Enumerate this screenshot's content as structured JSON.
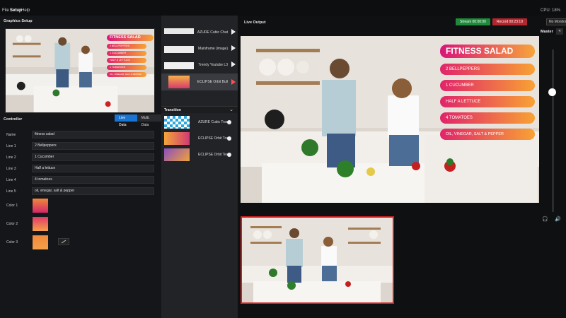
{
  "menu": {
    "file": "File",
    "setup": "Setup",
    "help": "Help"
  },
  "cpu": "CPU: 18%",
  "left": {
    "graphics_title": "Graphics Setup",
    "controller_title": "Controller",
    "seg_live": "Live Data",
    "seg_multi": "Multi. Data",
    "fields": [
      {
        "label": "Name",
        "value": "fitness salad"
      },
      {
        "label": "Line 1",
        "value": "2 Bellpeppers"
      },
      {
        "label": "Line 2",
        "value": "1 Cucumber"
      },
      {
        "label": "Line 3",
        "value": "Half a lettuce"
      },
      {
        "label": "Line 4",
        "value": "4 tomatoes"
      },
      {
        "label": "Line 5",
        "value": "oil, vinegar, salt & pepper"
      }
    ],
    "colors": [
      {
        "label": "Color 1",
        "from": "#f0883a",
        "to": "#d4276a"
      },
      {
        "label": "Color 2",
        "from": "#e03a6a",
        "to": "#f4a04a"
      },
      {
        "label": "Color 3",
        "from": "#f08a3c",
        "to": "#f4a04a"
      }
    ]
  },
  "templates": [
    {
      "label": "AZURE Cubic Chat",
      "selected": false
    },
    {
      "label": "Mainframe (image)",
      "selected": false
    },
    {
      "label": "Trendy Youtube L3",
      "selected": false
    },
    {
      "label": "ECLIPSE Orbit Bull",
      "selected": true
    }
  ],
  "transition": {
    "title": "Transition",
    "items": [
      {
        "label": "AZURE Cubic Trans"
      },
      {
        "label": "ECLIPSE Orbit Trar"
      },
      {
        "label": "ECLIPSE Orbit Text"
      }
    ]
  },
  "output": {
    "title": "Live Output",
    "stream": "Stream 00:00:00",
    "record": "Record 00:23:19",
    "monitor": "No Monitor",
    "master": "Master",
    "stream_color": "#1f8a3a",
    "record_color": "#b3262e"
  },
  "overlay": {
    "title": "FITNESS SALAD",
    "lines": [
      "2 BELLPEPPERS",
      "1 CUCUMBER",
      "HALF A LETTUCE",
      "4 TOMATOES",
      "OIL, VINEGAR, SALT & PEPPER"
    ]
  },
  "volume": {
    "level": 0.75
  }
}
